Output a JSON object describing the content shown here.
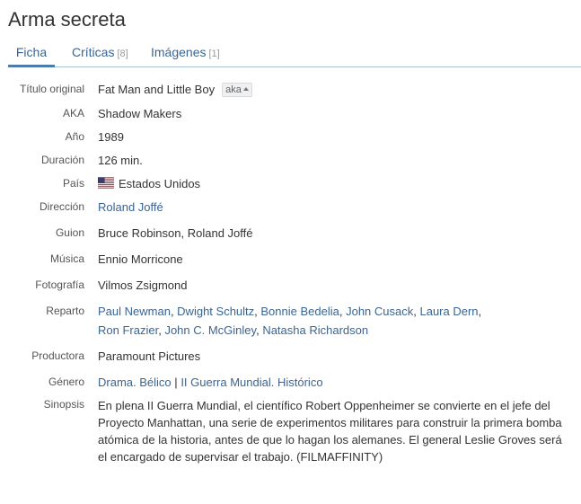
{
  "page": {
    "title": "Arma secreta"
  },
  "tabs": [
    {
      "label": "Ficha",
      "count": "",
      "active": true
    },
    {
      "label": "Críticas",
      "count": "[8]",
      "active": false
    },
    {
      "label": "Imágenes",
      "count": "[1]",
      "active": false
    }
  ],
  "details": {
    "original_title_label": "Título original",
    "original_title": "Fat Man and Little Boy",
    "aka_badge": "aka",
    "aka_label": "AKA",
    "aka": "Shadow Makers",
    "year_label": "Año",
    "year": "1989",
    "duration_label": "Duración",
    "duration": "126 min.",
    "country_label": "País",
    "country": "Estados Unidos",
    "country_flag": "us-flag-icon",
    "director_label": "Dirección",
    "director": "Roland Joffé",
    "script_label": "Guion",
    "script": "Bruce Robinson, Roland Joffé",
    "music_label": "Música",
    "music": "Ennio Morricone",
    "photography_label": "Fotografía",
    "photography": "Vilmos Zsigmond",
    "cast_label": "Reparto",
    "cast": [
      "Paul Newman",
      "Dwight Schultz",
      "Bonnie Bedelia",
      "John Cusack",
      "Laura Dern",
      "Ron Frazier",
      "John C. McGinley",
      "Natasha Richardson"
    ],
    "producer_label": "Productora",
    "producer": "Paramount Pictures",
    "genre_label": "Género",
    "genre": [
      "Drama.",
      "Bélico",
      "II Guerra Mundial.",
      "Histórico"
    ],
    "genre_separator": "|",
    "synopsis_label": "Sinopsis",
    "synopsis": "En plena II Guerra Mundial, el científico Robert Oppenheimer se convierte en el jefe del Proyecto Manhattan, una serie de experimentos militares para construir la primera bomba atómica de la historia, antes de que lo hagan los alemanes. El general Leslie Groves será el encargado de supervisar el trabajo. (FILMAFFINITY)"
  },
  "colors": {
    "link": "#3b6592",
    "tab_underline": "#4a7cb0"
  }
}
